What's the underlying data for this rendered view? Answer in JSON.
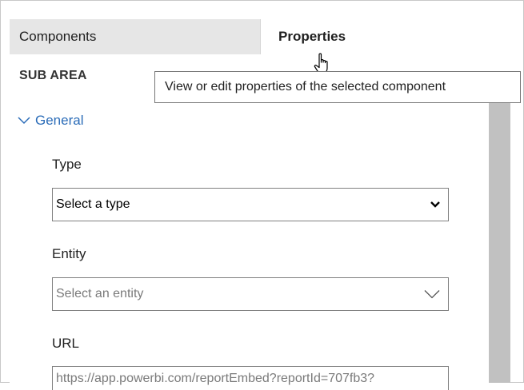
{
  "tabs": {
    "components": "Components",
    "properties": "Properties"
  },
  "tooltip": "View or edit properties of the selected component",
  "section": {
    "title": "SUB AREA",
    "group": "General"
  },
  "fields": {
    "type": {
      "label": "Type",
      "selected": "Select a type"
    },
    "entity": {
      "label": "Entity",
      "placeholder": "Select an entity"
    },
    "url": {
      "label": "URL",
      "value": "https://app.powerbi.com/reportEmbed?reportId=707fb3?"
    }
  },
  "colors": {
    "link": "#2b6cb8",
    "tab_inactive": "#e6e6e6",
    "scroll_thumb": "#c1c1c1"
  },
  "icons": {
    "cursor": "hand-pointer-icon",
    "general_chevron": "chevron-down-icon",
    "type_chevron": "chevron-down-icon",
    "entity_chevron": "chevron-down-icon"
  }
}
